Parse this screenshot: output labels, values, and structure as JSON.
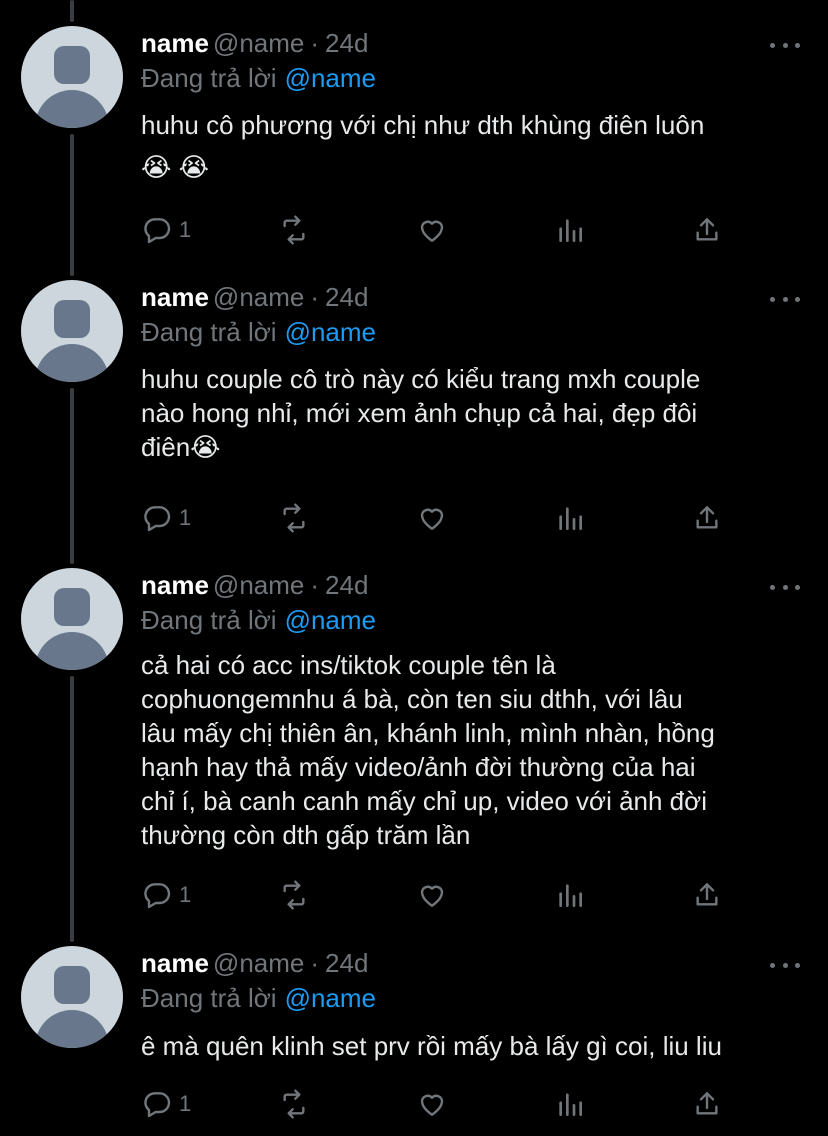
{
  "tweets": [
    {
      "display_name": "name",
      "handle": "@name",
      "separator": "·",
      "time": "24d",
      "reply_prefix": "Đang trả lời",
      "reply_to": "@name",
      "text": "huhu cô phương với chị như dth khùng điên luôn",
      "emoji": "😭 😭",
      "reply_count": "1"
    },
    {
      "display_name": "name",
      "handle": "@name",
      "separator": "·",
      "time": "24d",
      "reply_prefix": "Đang trả lời",
      "reply_to": "@name",
      "text": "huhu couple cô trò này có kiểu trang mxh couple\nnào hong nhỉ, mới xem ảnh chụp cả hai, đẹp đôi\nđiên😭",
      "reply_count": "1"
    },
    {
      "display_name": "name",
      "handle": "@name",
      "separator": "·",
      "time": "24d",
      "reply_prefix": "Đang trả lời",
      "reply_to": "@name",
      "text": "cả hai có acc ins/tiktok couple tên là\ncophuongemnhu á bà, còn ten siu dthh, với lâu\nlâu mấy chị thiên ân, khánh linh, mình nhàn, hồng\nhạnh hay thả mấy video/ảnh đời thường của hai\nchỉ í, bà canh canh mấy chỉ up, video với ảnh đời\nthường còn dth gấp trăm lần",
      "reply_count": "1"
    },
    {
      "display_name": "name",
      "handle": "@name",
      "separator": "·",
      "time": "24d",
      "reply_prefix": "Đang trả lời",
      "reply_to": "@name",
      "text": "ê mà quên klinh set prv rồi mấy bà lấy gì coi, liu liu",
      "reply_count": "1"
    }
  ],
  "icons": {
    "reply": "reply-icon",
    "retweet": "retweet-icon",
    "like": "heart-icon",
    "views": "views-icon",
    "share": "share-icon",
    "more": "more-icon"
  },
  "colors": {
    "background": "#000000",
    "text": "#e7e9ea",
    "secondary": "#71767b",
    "accent": "#1d9bf0",
    "thread_line": "#3a3d41"
  }
}
